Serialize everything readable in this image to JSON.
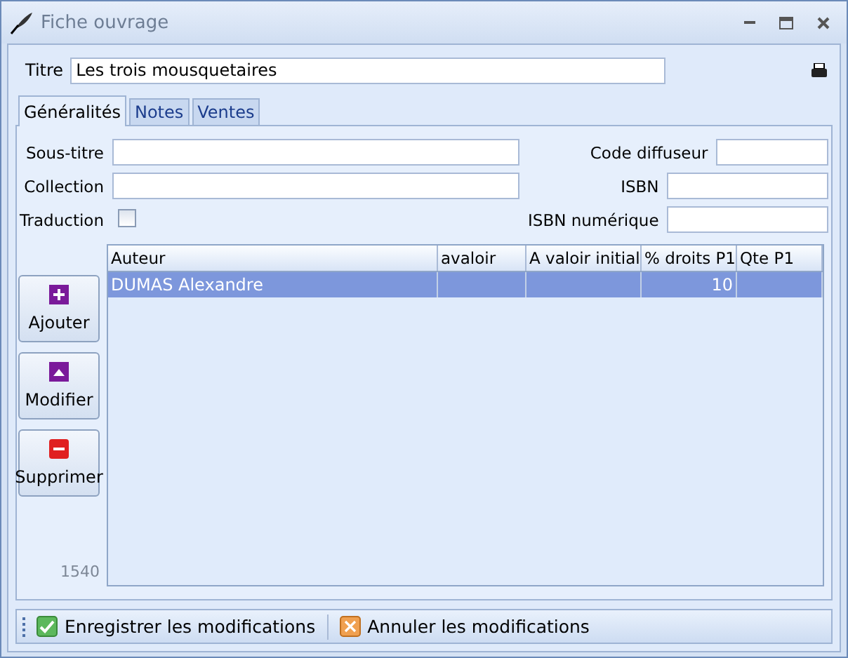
{
  "window": {
    "title": "Fiche ouvrage"
  },
  "titre": {
    "label": "Titre",
    "value": "Les trois mousquetaires"
  },
  "tabs": [
    {
      "label": "Généralités",
      "selected": true
    },
    {
      "label": "Notes",
      "selected": false
    },
    {
      "label": "Ventes",
      "selected": false
    }
  ],
  "fields_left": [
    {
      "label": "Sous-titre"
    },
    {
      "label": "Collection"
    }
  ],
  "traduction": {
    "label": "Traduction",
    "checked": false
  },
  "fields_right": [
    {
      "label": "Code diffuseur"
    },
    {
      "label": "ISBN"
    },
    {
      "label": "ISBN numérique"
    }
  ],
  "side_buttons": [
    {
      "label": "Ajouter",
      "kind": "add"
    },
    {
      "label": "Modifier",
      "kind": "edit"
    },
    {
      "label": "Supprimer",
      "kind": "delete"
    }
  ],
  "count": "1540",
  "table": {
    "columns": [
      "Auteur",
      "avaloir",
      "A valoir initial",
      "% droits P1",
      "Qte P1"
    ],
    "rows": [
      {
        "cells": [
          "DUMAS Alexandre",
          null,
          null,
          "10",
          null
        ],
        "selected": true
      }
    ]
  },
  "toolbar": [
    {
      "label": "Enregistrer les modifications",
      "kind": "save"
    },
    {
      "label": "Annuler les modifications",
      "kind": "cancel"
    }
  ]
}
